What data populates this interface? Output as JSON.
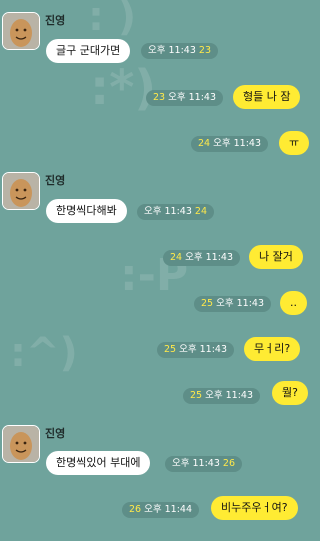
{
  "sender": "진영",
  "accent_colors": {
    "incoming": "#ffffff",
    "outgoing": "#ffeb33",
    "unread_count": "#ffe94a",
    "background": "#6fa39c"
  },
  "messages": [
    {
      "side": "in",
      "text": "글구 군대가면",
      "time": "오후 11:43",
      "count": "23"
    },
    {
      "side": "out",
      "text": "형들 나 잠",
      "time": "오후 11:43",
      "count": "23"
    },
    {
      "side": "out",
      "text": "ㅠ",
      "time": "오후 11:43",
      "count": "24"
    },
    {
      "side": "in",
      "text": "한명씩다해봐",
      "time": "오후 11:43",
      "count": "24"
    },
    {
      "side": "out",
      "text": "나 잘거",
      "time": "오후 11:43",
      "count": "24"
    },
    {
      "side": "out",
      "text": "..",
      "time": "오후 11:43",
      "count": "25"
    },
    {
      "side": "out",
      "text": "무ㅓ리?",
      "time": "오후 11:43",
      "count": "25"
    },
    {
      "side": "out",
      "text": "뭘?",
      "time": "오후 11:43",
      "count": "25"
    },
    {
      "side": "in",
      "text": "한명씩있어 부대에",
      "time": "오후 11:43",
      "count": "26"
    },
    {
      "side": "out",
      "text": "비누주우ㅓ여?",
      "time": "오후 11:44",
      "count": "26"
    }
  ]
}
